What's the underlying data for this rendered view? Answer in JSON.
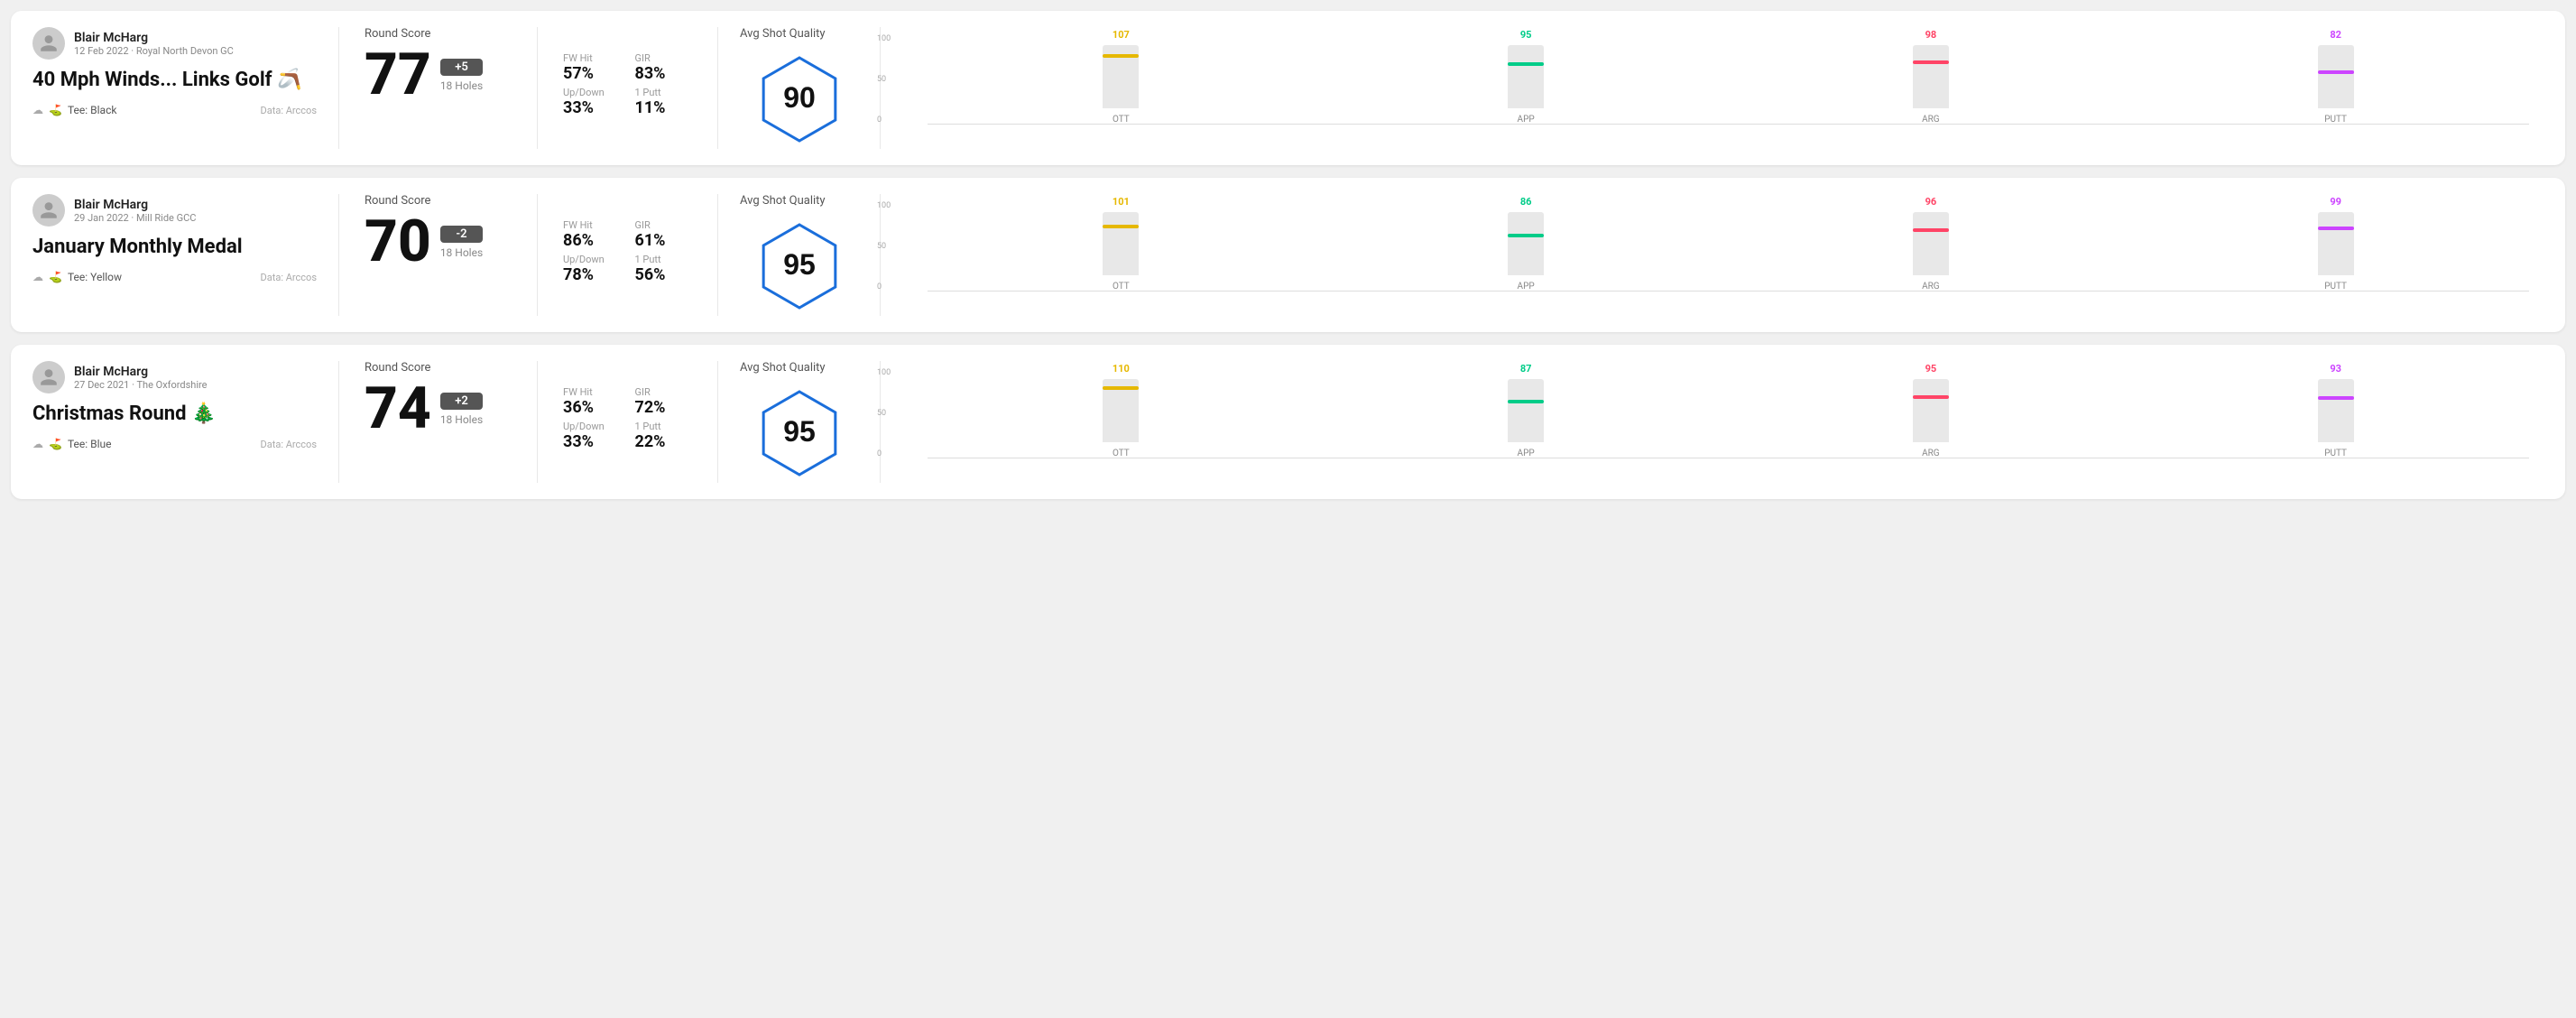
{
  "rounds": [
    {
      "id": "round1",
      "user": {
        "name": "Blair McHarg",
        "date": "12 Feb 2022 · Royal North Devon GC"
      },
      "title": "40 Mph Winds... Links Golf 🪃",
      "tee": "Black",
      "data_source": "Data: Arccos",
      "score": {
        "value": "77",
        "modifier": "+5",
        "modifier_type": "over",
        "holes": "18 Holes"
      },
      "stats": {
        "fw_hit_label": "FW Hit",
        "fw_hit_value": "57%",
        "gir_label": "GIR",
        "gir_value": "83%",
        "updown_label": "Up/Down",
        "updown_value": "33%",
        "oneputt_label": "1 Putt",
        "oneputt_value": "11%"
      },
      "quality": {
        "label": "Avg Shot Quality",
        "score": "90"
      },
      "chart": {
        "bars": [
          {
            "label": "OTT",
            "value": 107,
            "color": "#e6b800",
            "pct": 85
          },
          {
            "label": "APP",
            "value": 95,
            "color": "#00cc88",
            "pct": 72
          },
          {
            "label": "ARG",
            "value": 98,
            "color": "#ff4466",
            "pct": 75
          },
          {
            "label": "PUTT",
            "value": 82,
            "color": "#cc44ff",
            "pct": 60
          }
        ],
        "y_labels": [
          "100",
          "50",
          "0"
        ]
      }
    },
    {
      "id": "round2",
      "user": {
        "name": "Blair McHarg",
        "date": "29 Jan 2022 · Mill Ride GCC"
      },
      "title": "January Monthly Medal",
      "tee": "Yellow",
      "data_source": "Data: Arccos",
      "score": {
        "value": "70",
        "modifier": "-2",
        "modifier_type": "under",
        "holes": "18 Holes"
      },
      "stats": {
        "fw_hit_label": "FW Hit",
        "fw_hit_value": "86%",
        "gir_label": "GIR",
        "gir_value": "61%",
        "updown_label": "Up/Down",
        "updown_value": "78%",
        "oneputt_label": "1 Putt",
        "oneputt_value": "56%"
      },
      "quality": {
        "label": "Avg Shot Quality",
        "score": "95"
      },
      "chart": {
        "bars": [
          {
            "label": "OTT",
            "value": 101,
            "color": "#e6b800",
            "pct": 80
          },
          {
            "label": "APP",
            "value": 86,
            "color": "#00cc88",
            "pct": 65
          },
          {
            "label": "ARG",
            "value": 96,
            "color": "#ff4466",
            "pct": 74
          },
          {
            "label": "PUTT",
            "value": 99,
            "color": "#cc44ff",
            "pct": 77
          }
        ],
        "y_labels": [
          "100",
          "50",
          "0"
        ]
      }
    },
    {
      "id": "round3",
      "user": {
        "name": "Blair McHarg",
        "date": "27 Dec 2021 · The Oxfordshire"
      },
      "title": "Christmas Round 🎄",
      "tee": "Blue",
      "data_source": "Data: Arccos",
      "score": {
        "value": "74",
        "modifier": "+2",
        "modifier_type": "over",
        "holes": "18 Holes"
      },
      "stats": {
        "fw_hit_label": "FW Hit",
        "fw_hit_value": "36%",
        "gir_label": "GIR",
        "gir_value": "72%",
        "updown_label": "Up/Down",
        "updown_value": "33%",
        "oneputt_label": "1 Putt",
        "oneputt_value": "22%"
      },
      "quality": {
        "label": "Avg Shot Quality",
        "score": "95"
      },
      "chart": {
        "bars": [
          {
            "label": "OTT",
            "value": 110,
            "color": "#e6b800",
            "pct": 88
          },
          {
            "label": "APP",
            "value": 87,
            "color": "#00cc88",
            "pct": 66
          },
          {
            "label": "ARG",
            "value": 95,
            "color": "#ff4466",
            "pct": 73
          },
          {
            "label": "PUTT",
            "value": 93,
            "color": "#cc44ff",
            "pct": 72
          }
        ],
        "y_labels": [
          "100",
          "50",
          "0"
        ]
      }
    }
  ],
  "labels": {
    "round_score": "Round Score",
    "avg_shot_quality": "Avg Shot Quality",
    "fw_hit": "FW Hit",
    "gir": "GIR",
    "updown": "Up/Down",
    "oneputt": "1 Putt",
    "data_arccos": "Data: Arccos"
  }
}
